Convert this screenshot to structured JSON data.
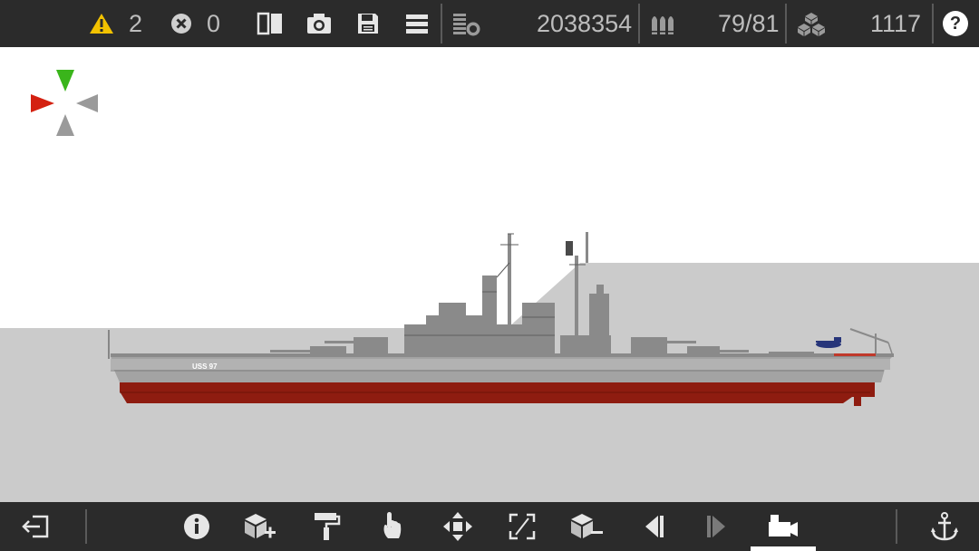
{
  "topbar": {
    "warnings_count": "2",
    "errors_count": "0",
    "cost": "2038354",
    "ammo": "79/81",
    "parts_count": "1117",
    "help_label": "?"
  },
  "ship": {
    "hull_label": "USS 97"
  },
  "bottombar": {
    "active_tool": "camera-mode"
  },
  "colors": {
    "bar_bg": "#2b2b2b",
    "icon": "#d8d8d8",
    "warning": "#f2c200",
    "hull_red": "#8e1c10",
    "hull_gray": "#9d9d9d",
    "water": "#cbcbcb",
    "compass_green": "#3ab51b",
    "compass_red": "#d42111",
    "compass_gray": "#9a9a9a"
  }
}
